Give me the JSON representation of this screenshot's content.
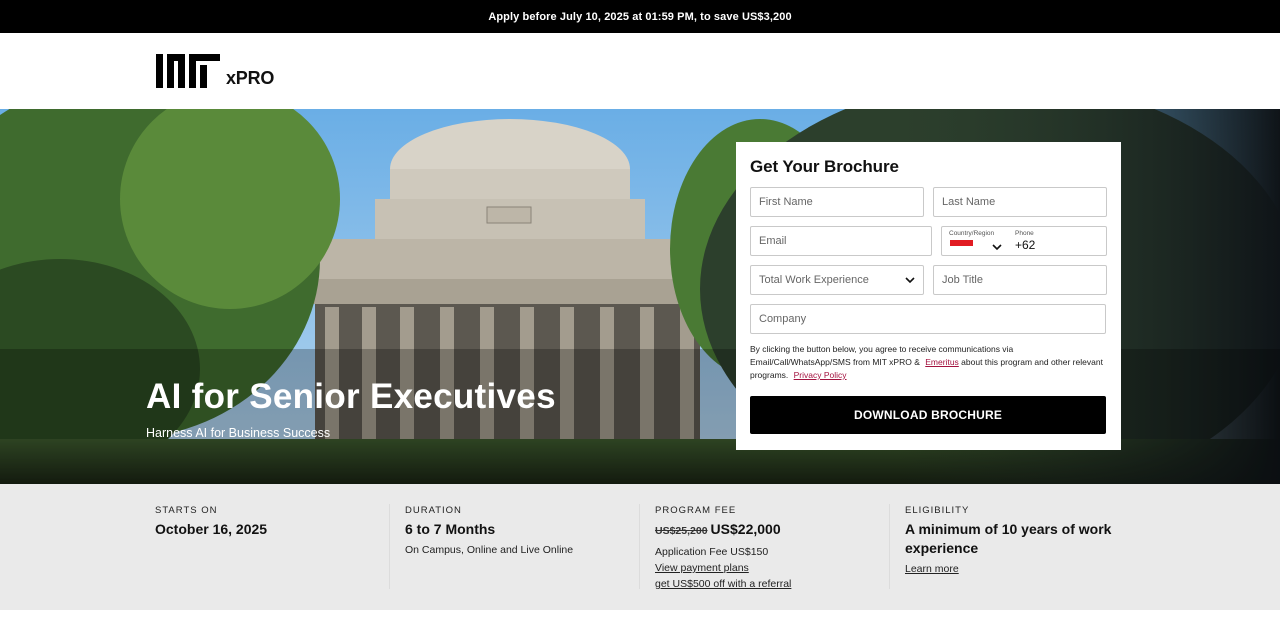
{
  "promo": {
    "text": "Apply before July 10, 2025 at 01:59 PM, to save US$3,200"
  },
  "header": {
    "logo_text": "xPRO"
  },
  "hero": {
    "title": "AI for Senior Executives",
    "subtitle": "Harness AI for Business Success"
  },
  "form": {
    "title": "Get Your Brochure",
    "first_name_placeholder": "First Name",
    "last_name_placeholder": "Last Name",
    "email_placeholder": "Email",
    "country_label": "Country/Region",
    "phone_label": "Phone",
    "phone_value": "+62",
    "experience_placeholder": "Total Work Experience",
    "job_title_placeholder": "Job Title",
    "company_placeholder": "Company",
    "consent_text_1": "By clicking the button below, you agree to receive communications via Email/Call/WhatsApp/SMS from MIT xPRO &",
    "consent_link_1": "Emeritus",
    "consent_text_2": " about this program and other relevant programs.",
    "consent_link_2": "Privacy Policy",
    "button_label": "DOWNLOAD BROCHURE",
    "flag_color": "#e11b22"
  },
  "info": {
    "starts": {
      "label": "STARTS ON",
      "value": "October 16, 2025"
    },
    "duration": {
      "label": "DURATION",
      "value": "6 to 7 Months",
      "detail": "On Campus, Online and Live Online"
    },
    "fee": {
      "label": "PROGRAM FEE",
      "old_price": "US$25,200",
      "price": "US$22,000",
      "application_fee": "Application Fee US$150",
      "payment_link": "View payment plans",
      "referral_link": "get US$500 off with a referral"
    },
    "eligibility": {
      "label": "ELIGIBILITY",
      "value": "A minimum of 10 years of work experience",
      "link": "Learn more"
    }
  }
}
